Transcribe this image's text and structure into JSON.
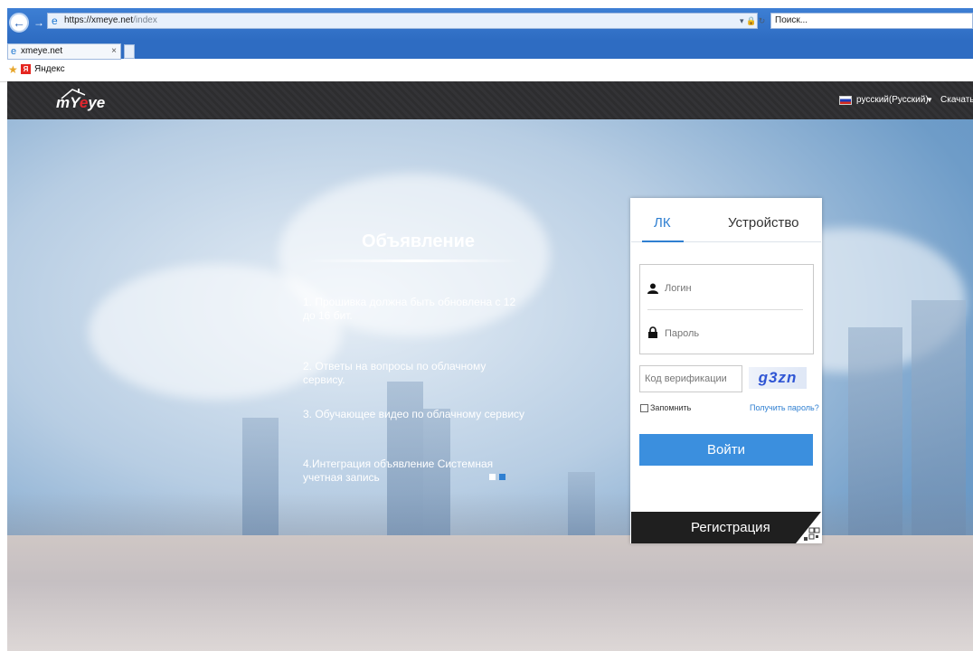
{
  "browser": {
    "url_main": "https://xmeye.net",
    "url_rest": "/index",
    "search_placeholder": "Поиск...",
    "tab_title": "xmeye.net",
    "tab_close": "×",
    "favorites": [
      {
        "label": "Яндекс"
      }
    ]
  },
  "header": {
    "logo_text_prefix": "m",
    "logo_text_mid": "Y",
    "logo_text_e": "e",
    "logo_text_suffix": "ye",
    "language": "русский(Русский)",
    "language_caret": "▼",
    "download": "Скачать"
  },
  "announcement": {
    "title": "Объявление",
    "items": [
      "1. Прошивка должна быть обновлена с 12 до 16 бит.",
      "2. Ответы на вопросы по облачному сервису.",
      "3. Обучающее видео по облачному сервису",
      "4.Интеграция объявление Системная учетная запись"
    ]
  },
  "login": {
    "tab_account": "ЛК",
    "tab_device": "Устройство",
    "login_placeholder": "Логин",
    "password_placeholder": "Пароль",
    "verification_placeholder": "Код верификации",
    "captcha_text": "g3zn",
    "remember_label": "Запомнить",
    "forgot_link": "Получить пароль?",
    "submit_label": "Войти",
    "register_label": "Регистрация"
  },
  "colors": {
    "accent": "#3b8fde",
    "header_bg": "#2f2f31",
    "register_bg": "#1f1f1f",
    "logo_red": "#e0262d"
  },
  "icons": [
    "back-arrow-icon",
    "forward-arrow-icon",
    "ie-page-icon",
    "lock-icon",
    "refresh-icon",
    "favorites-star-icon",
    "yandex-icon",
    "user-icon",
    "password-lock-icon",
    "qr-code-icon",
    "russian-flag-icon"
  ]
}
